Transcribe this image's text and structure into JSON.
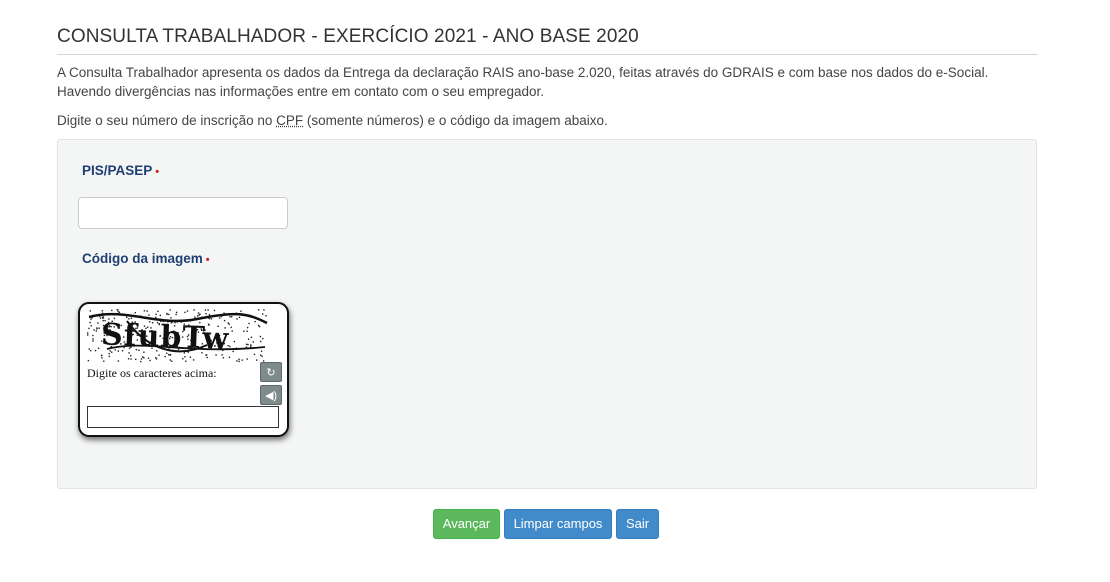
{
  "page": {
    "title": "CONSULTA TRABALHADOR - EXERCÍCIO 2021 - ANO BASE 2020",
    "intro": "A Consulta Trabalhador apresenta os dados da Entrega da declaração RAIS ano-base 2.020, feitas através do GDRAIS e com base nos dados do e-Social. Havendo divergências nas informações entre em contato com o seu empregador.",
    "instruction_prefix": "Digite o seu número de inscrição no ",
    "instruction_abbr": "CPF",
    "instruction_suffix": " (somente números) e o código da imagem abaixo."
  },
  "form": {
    "pis_label": "PIS/PASEP",
    "pis_value": "",
    "required_marker": "•",
    "captcha_label": "Código da imagem",
    "captcha": {
      "image_text": "SfubTw",
      "prompt": "Digite os caracteres acima:",
      "input_value": "",
      "refresh_icon": "refresh-icon",
      "audio_icon": "audio-icon"
    }
  },
  "actions": {
    "advance_label": "Avançar",
    "clear_label": "Limpar campos",
    "exit_label": "Sair"
  },
  "colors": {
    "label_blue": "#1f3f73",
    "required_red": "#cc2222",
    "advance_green": "#5cb85c",
    "primary_blue": "#428bca",
    "panel_bg": "#f4f5f5"
  }
}
